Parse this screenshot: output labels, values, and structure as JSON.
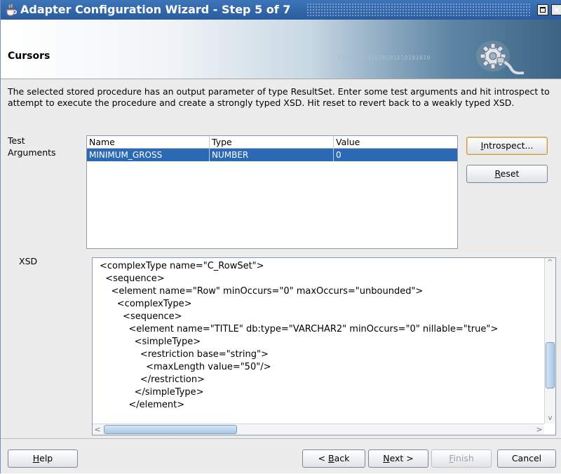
{
  "window": {
    "title": "Adapter Configuration Wizard - Step 5 of 7",
    "icons": {
      "app": "java-cup-icon",
      "maximize": "maximize-icon",
      "close": "close-icon"
    }
  },
  "header": {
    "heading": "Cursors",
    "binary_text": "0101010101010101010101010",
    "graphic": "gear-plug-icon"
  },
  "description": "The selected stored procedure has an output parameter of type ResultSet.  Enter some test arguments and hit introspect to attempt to execute the procedure and create a strongly typed XSD.  Hit reset to revert back to a weakly typed XSD.",
  "test_arguments": {
    "label_line1": "Test",
    "label_line2": "Arguments",
    "columns": [
      "Name",
      "Type",
      "Value"
    ],
    "rows": [
      {
        "name": "MINIMUM_GROSS",
        "type": "NUMBER",
        "value": "0",
        "selected": true
      }
    ]
  },
  "buttons": {
    "introspect_mnemonic": "I",
    "introspect_rest": "ntrospect...",
    "reset_mnemonic": "R",
    "reset_rest": "eset"
  },
  "xsd": {
    "label": "XSD",
    "lines": [
      "<complexType name=\"C_RowSet\">",
      "  <sequence>",
      "    <element name=\"Row\" minOccurs=\"0\" maxOccurs=\"unbounded\">",
      "      <complexType>",
      "        <sequence>",
      "          <element name=\"TITLE\" db:type=\"VARCHAR2\" minOccurs=\"0\" nillable=\"true\">",
      "            <simpleType>",
      "              <restriction base=\"string\">",
      "                <maxLength value=\"50\"/>",
      "              </restriction>",
      "            </simpleType>",
      "          </element>"
    ]
  },
  "footer": {
    "help_mnemonic": "H",
    "help_rest": "elp",
    "back_prefix": "< ",
    "back_mnemonic": "B",
    "back_rest": "ack",
    "next_mnemonic": "N",
    "next_rest": "ext >",
    "finish_mnemonic": "F",
    "finish_rest": "inish",
    "cancel_label": "Cancel"
  },
  "colors": {
    "titlebar": "#3d74b8",
    "selection": "#2b69b5",
    "focus_border": "#c79a4a"
  }
}
